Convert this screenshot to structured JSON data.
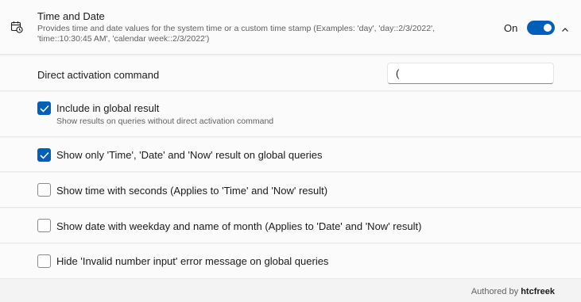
{
  "header": {
    "title": "Time and Date",
    "description": "Provides time and date values for the system time or a custom time stamp (Examples: 'day', 'day::2/3/2022', 'time::10:30:45 AM', 'calendar week::2/3/2022')",
    "toggle_label": "On",
    "toggle_state": true,
    "icon": "calendar-clock-icon",
    "accent_color": "#005fb8"
  },
  "activation": {
    "label": "Direct activation command",
    "value": "("
  },
  "options": [
    {
      "label": "Include in global result",
      "sub": "Show results on queries without direct activation command",
      "checked": true
    },
    {
      "label": "Show only 'Time', 'Date' and 'Now' result on global queries",
      "checked": true
    },
    {
      "label": "Show time with seconds (Applies to 'Time' and 'Now' result)",
      "checked": false
    },
    {
      "label": "Show date with weekday and name of month (Applies to 'Date' and 'Now' result)",
      "checked": false
    },
    {
      "label": "Hide 'Invalid number input' error message on global queries",
      "checked": false
    }
  ],
  "footer": {
    "authored_prefix": "Authored by",
    "author": "htcfreek"
  }
}
